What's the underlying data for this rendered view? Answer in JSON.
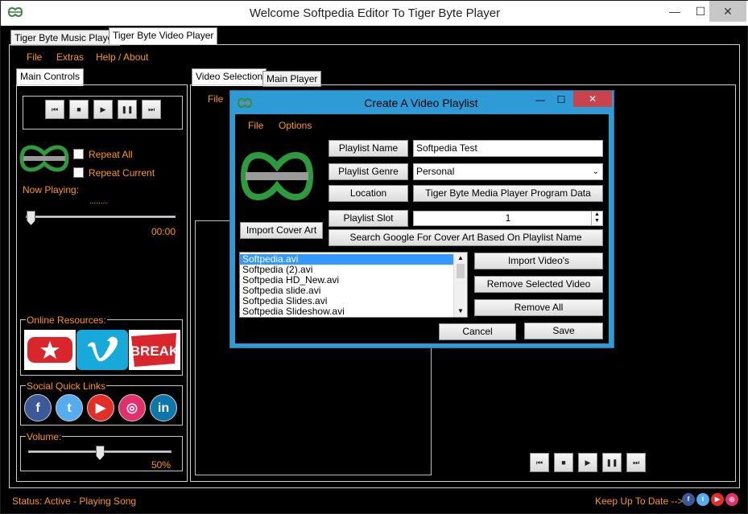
{
  "window": {
    "title": "Welcome Softpedia Editor To Tiger Byte Player",
    "minimize": "—",
    "maximize": "☐",
    "close": "✕"
  },
  "top_tabs": [
    {
      "label": "Tiger Byte Music Player"
    },
    {
      "label": "Tiger Byte Video Player"
    }
  ],
  "main_menu": {
    "file": "File",
    "extras": "Extras",
    "help": "Help / About"
  },
  "left_panel": {
    "tab": "Main Controls",
    "transport": [
      "⏮",
      "■",
      "▶",
      "❚❚",
      "⏭"
    ],
    "repeat_all": "Repeat All",
    "repeat_current": "Repeat Current",
    "now_playing_label": "Now Playing:",
    "now_playing_value": "........",
    "position_time": "00:00",
    "position_fraction": 0.0,
    "online_resources_label": "Online Resources:",
    "online_resources": [
      "youtube-star-icon",
      "vimeo-icon",
      "break-icon"
    ],
    "break_text": "BREAK",
    "social_label": "Social Quick Links",
    "social": [
      {
        "icon": "facebook-icon",
        "glyph": "f",
        "color": "#3b5998"
      },
      {
        "icon": "twitter-icon",
        "glyph": "t",
        "color": "#55acee"
      },
      {
        "icon": "youtube-icon",
        "glyph": "▶",
        "color": "#e52d27"
      },
      {
        "icon": "instagram-icon",
        "glyph": "◎",
        "color": "#e1306c"
      },
      {
        "icon": "linkedin-icon",
        "glyph": "in",
        "color": "#0e76a8"
      }
    ],
    "volume_label": "Volume:",
    "volume_value": "50%",
    "volume_fraction": 0.5
  },
  "video_area": {
    "tabs": [
      {
        "label": "Video Selection"
      },
      {
        "label": "Main Player"
      }
    ],
    "menu_file": "File",
    "transport": [
      "⏮",
      "■",
      "▶",
      "❚❚",
      "⏭"
    ]
  },
  "dialog": {
    "title": "Create A Video Playlist",
    "minimize": "—",
    "maximize": "☐",
    "close": "✕",
    "menu": {
      "file": "File",
      "options": "Options"
    },
    "playlist_name_label": "Playlist Name",
    "playlist_name_value": "Softpedia Test",
    "playlist_genre_label": "Playlist Genre",
    "playlist_genre_value": "Personal",
    "location_label": "Location",
    "location_value": "Tiger Byte Media Player Program Data",
    "playlist_slot_label": "Playlist Slot",
    "playlist_slot_value": "1",
    "import_cover_art": "Import Cover Art",
    "search_google": "Search Google For Cover Art Based On Playlist Name",
    "videos": [
      "Softpedia.avi",
      "Softpedia (2).avi",
      "Softpedia HD_New.avi",
      "Softpedia slide.avi",
      "Softpedia Slides.avi",
      "Softpedia Slideshow.avi"
    ],
    "selected_index": 0,
    "import_videos": "Import Video's",
    "remove_selected": "Remove Selected Video",
    "remove_all": "Remove All",
    "cancel": "Cancel",
    "save": "Save"
  },
  "status_bar": {
    "status": "Status: Active - Playing Song",
    "keep_up": "Keep Up To Date -->"
  },
  "colors": {
    "accent": "#ff9a00",
    "dialog_frame": "#2f9bd6",
    "selection": "#3399ff"
  }
}
